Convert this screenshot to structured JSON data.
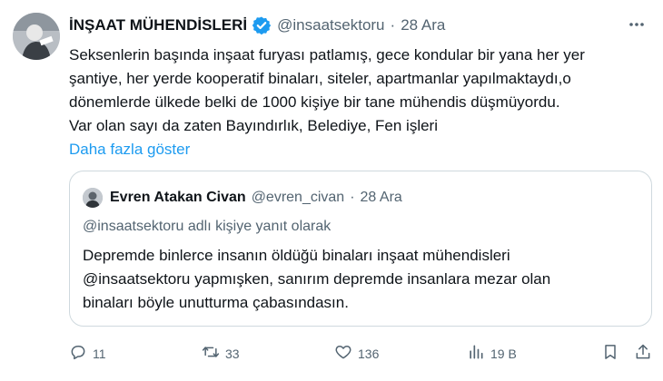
{
  "tweet": {
    "author_name": "İNŞAAT MÜHENDİSLERİ",
    "handle": "@insaatsektoru",
    "separator": "·",
    "date": "28 Ara",
    "body_lines": [
      "Seksenlerin başında inşaat furyası patlamış, gece kondular bir yana her yer",
      "şantiye, her yerde kooperatif binaları, siteler, apartmanlar yapılmaktaydı,o",
      "dönemlerde ülkede belki de 1000 kişiye bir tane mühendis düşmüyordu.",
      "Var olan sayı da zaten Bayındırlık,  Belediye, Fen işleri"
    ],
    "show_more": "Daha fazla göster"
  },
  "quote": {
    "author_name": "Evren Atakan Civan",
    "handle": "@evren_civan",
    "separator": "·",
    "date": "28 Ara",
    "reply_to": "@insaatsektoru adlı kişiye yanıt olarak",
    "body_lines": [
      "Depremde binlerce insanın öldüğü binaları inşaat mühendisleri",
      "@insaatsektoru yapmışken, sanırım depremde insanlara mezar olan",
      "binaları böyle unutturma çabasındasın."
    ]
  },
  "actions": {
    "replies": "11",
    "retweets": "33",
    "likes": "136",
    "views": "19 B"
  },
  "colors": {
    "verified": "#1d9bf0",
    "link": "#1d9bf0",
    "secondary": "#536471",
    "border": "#cfd9de"
  }
}
